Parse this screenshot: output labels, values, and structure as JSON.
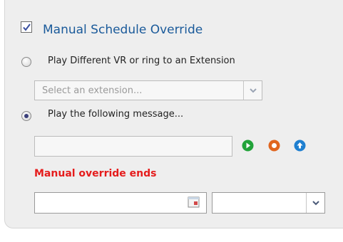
{
  "override": {
    "checked": true,
    "title": "Manual Schedule Override"
  },
  "option_extension": {
    "label": "Play Different VR or ring to an Extension",
    "selected": false,
    "select_placeholder": "Select an extension..."
  },
  "option_message": {
    "label": "Play the following message...",
    "selected": true,
    "message_value": ""
  },
  "buttons": {
    "play_icon": "play-icon",
    "record_icon": "record-icon",
    "upload_icon": "upload-icon",
    "colors": {
      "play": "#22a33a",
      "record": "#e0651e",
      "upload": "#1e7fd0"
    }
  },
  "ends": {
    "label": "Manual override ends",
    "date_value": "",
    "time_value": ""
  },
  "colors": {
    "title": "#1a5a9a",
    "ends_label": "#e51c1c",
    "panel_bg": "#eeeeee"
  }
}
